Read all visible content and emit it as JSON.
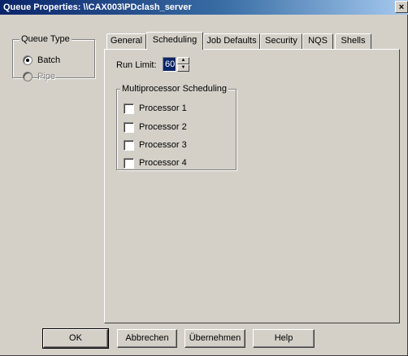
{
  "window": {
    "title": "Queue Properties: \\\\CAX003\\PDclash_server",
    "close_label": "×"
  },
  "queue_type": {
    "title": "Queue Type",
    "options": [
      {
        "label": "Batch",
        "checked": true,
        "enabled": true
      },
      {
        "label": "Pipe",
        "checked": false,
        "enabled": false
      }
    ]
  },
  "tabs": [
    {
      "label": "General",
      "active": false
    },
    {
      "label": "Scheduling",
      "active": true
    },
    {
      "label": "Job Defaults",
      "active": false
    },
    {
      "label": "Security",
      "active": false
    },
    {
      "label": "NQS",
      "active": false
    },
    {
      "label": "Shells",
      "active": false
    }
  ],
  "scheduling": {
    "run_limit_label": "Run Limit:",
    "run_limit_value": "60",
    "multiprocessor_title": "Multiprocessor Scheduling",
    "processors": [
      {
        "label": "Processor 1",
        "checked": false
      },
      {
        "label": "Processor 2",
        "checked": false
      },
      {
        "label": "Processor 3",
        "checked": false
      },
      {
        "label": "Processor 4",
        "checked": false
      }
    ]
  },
  "buttons": {
    "ok": "OK",
    "cancel": "Abbrechen",
    "apply": "Übernehmen",
    "help": "Help"
  }
}
